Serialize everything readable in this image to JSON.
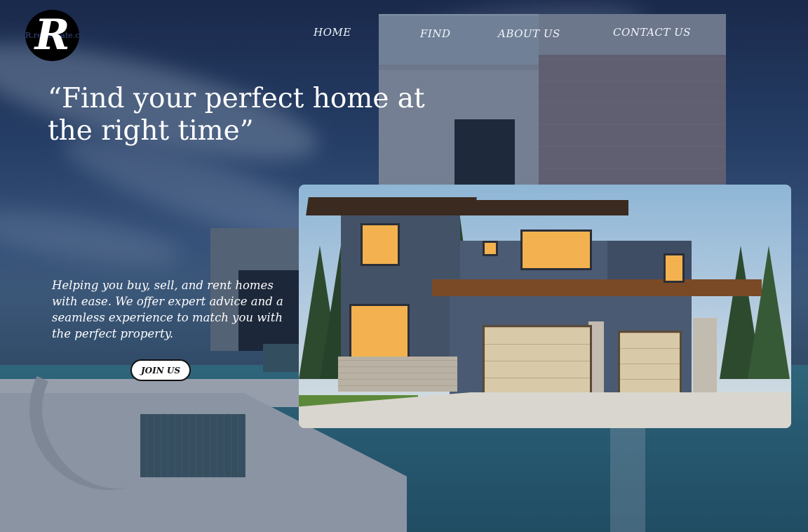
{
  "brand": {
    "logo_letter": "R",
    "logo_text": "R.realestate.co"
  },
  "nav": {
    "home": "HOME",
    "find": "FIND",
    "about": "ABOUT US",
    "contact": "CONTACT US"
  },
  "hero": {
    "headline": "“Find your perfect home at the right time”",
    "subtext": "Helping you buy, sell, and rent homes with ease. We offer expert advice and a seamless experience to match you with the perfect property.",
    "cta_label": "JOIN US"
  },
  "colors": {
    "text": "#ffffff",
    "button_bg": "#ffffff",
    "button_text": "#111111",
    "logo_bg": "#000000"
  }
}
